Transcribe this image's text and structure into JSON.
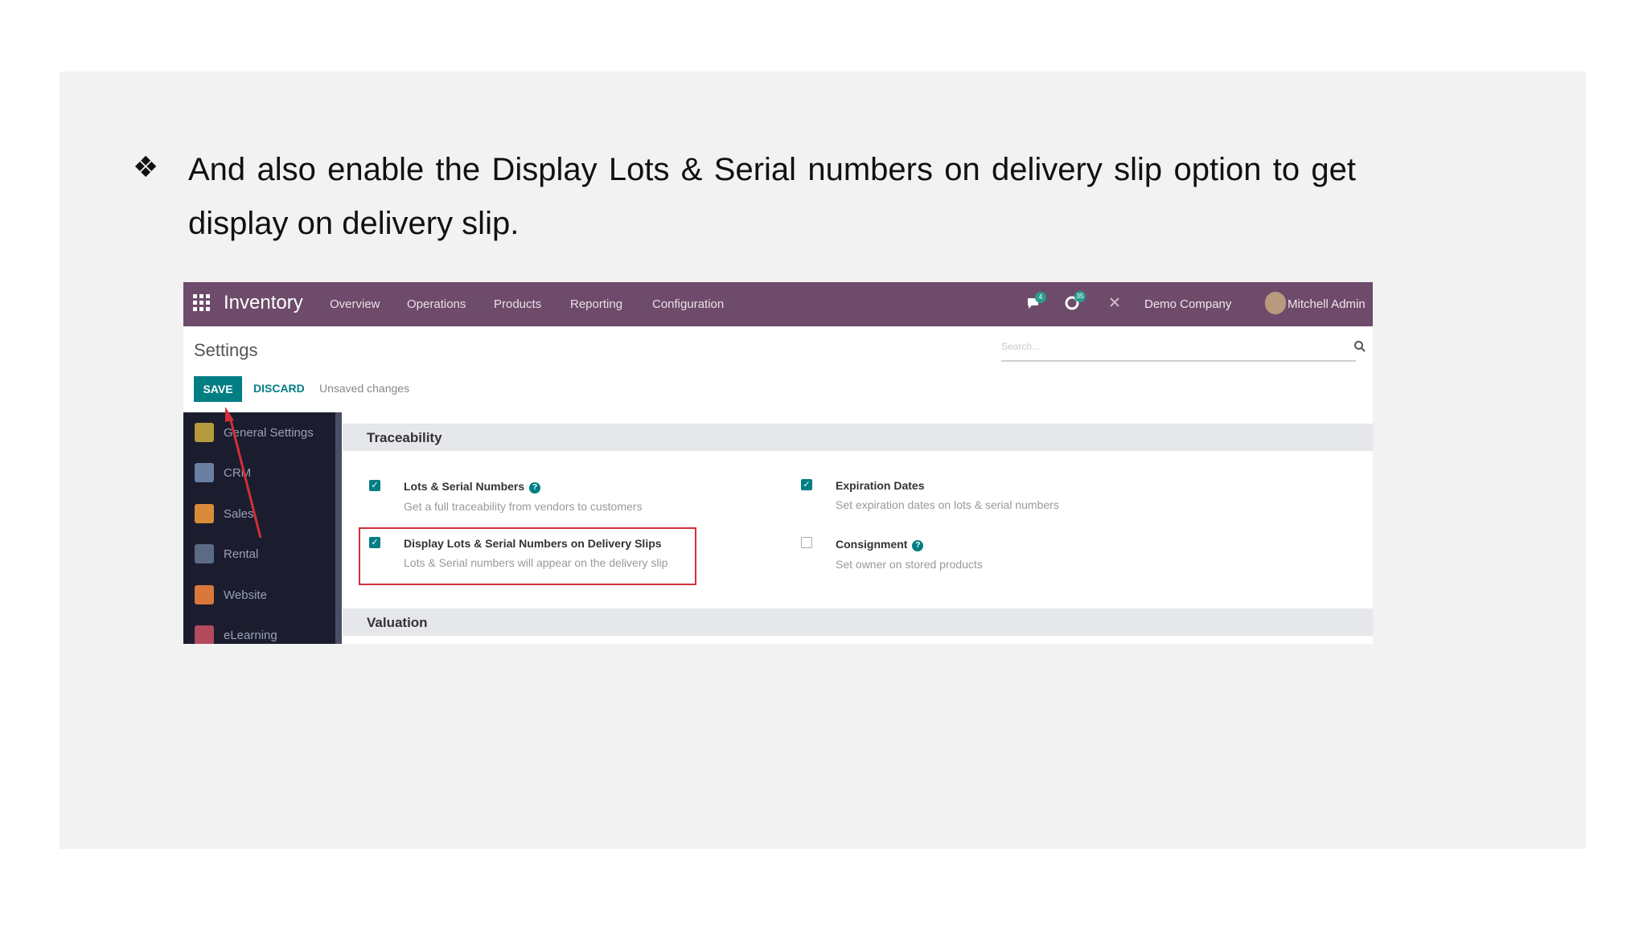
{
  "slide": {
    "bullet": "❖",
    "text": "And also enable the Display Lots & Serial numbers on delivery slip option to get display on delivery slip."
  },
  "app": {
    "name": "Inventory",
    "nav": [
      "Overview",
      "Operations",
      "Products",
      "Reporting",
      "Configuration"
    ],
    "messages_badge": "4",
    "activities_badge": "35",
    "company": "Demo Company",
    "user": "Mitchell Admin"
  },
  "settings": {
    "title": "Settings",
    "search_placeholder": "Search...",
    "save_label": "SAVE",
    "discard_label": "DISCARD",
    "unsaved_label": "Unsaved changes"
  },
  "sidebar": {
    "items": [
      {
        "label": "General Settings",
        "color": "#b59a3e"
      },
      {
        "label": "CRM",
        "color": "#6b7fa3"
      },
      {
        "label": "Sales",
        "color": "#d98b3a"
      },
      {
        "label": "Rental",
        "color": "#5b6b85"
      },
      {
        "label": "Website",
        "color": "#d9783a"
      },
      {
        "label": "eLearning",
        "color": "#b34a5e"
      }
    ]
  },
  "sections": {
    "traceability": "Traceability",
    "valuation": "Valuation"
  },
  "options": [
    {
      "title": "Lots & Serial Numbers",
      "desc": "Get a full traceability from vendors to customers",
      "checked": true,
      "help": true
    },
    {
      "title": "Expiration Dates",
      "desc": "Set expiration dates on lots & serial numbers",
      "checked": true,
      "help": false
    },
    {
      "title": "Display Lots & Serial Numbers on Delivery Slips",
      "desc": "Lots & Serial numbers will appear on the delivery slip",
      "checked": true,
      "help": false
    },
    {
      "title": "Consignment",
      "desc": "Set owner on stored products",
      "checked": false,
      "help": true
    }
  ],
  "colors": {
    "navbar": "#6e4b6a",
    "primary": "#017e84",
    "highlight": "#d32f3b",
    "sidebar": "#1b1d2e"
  }
}
